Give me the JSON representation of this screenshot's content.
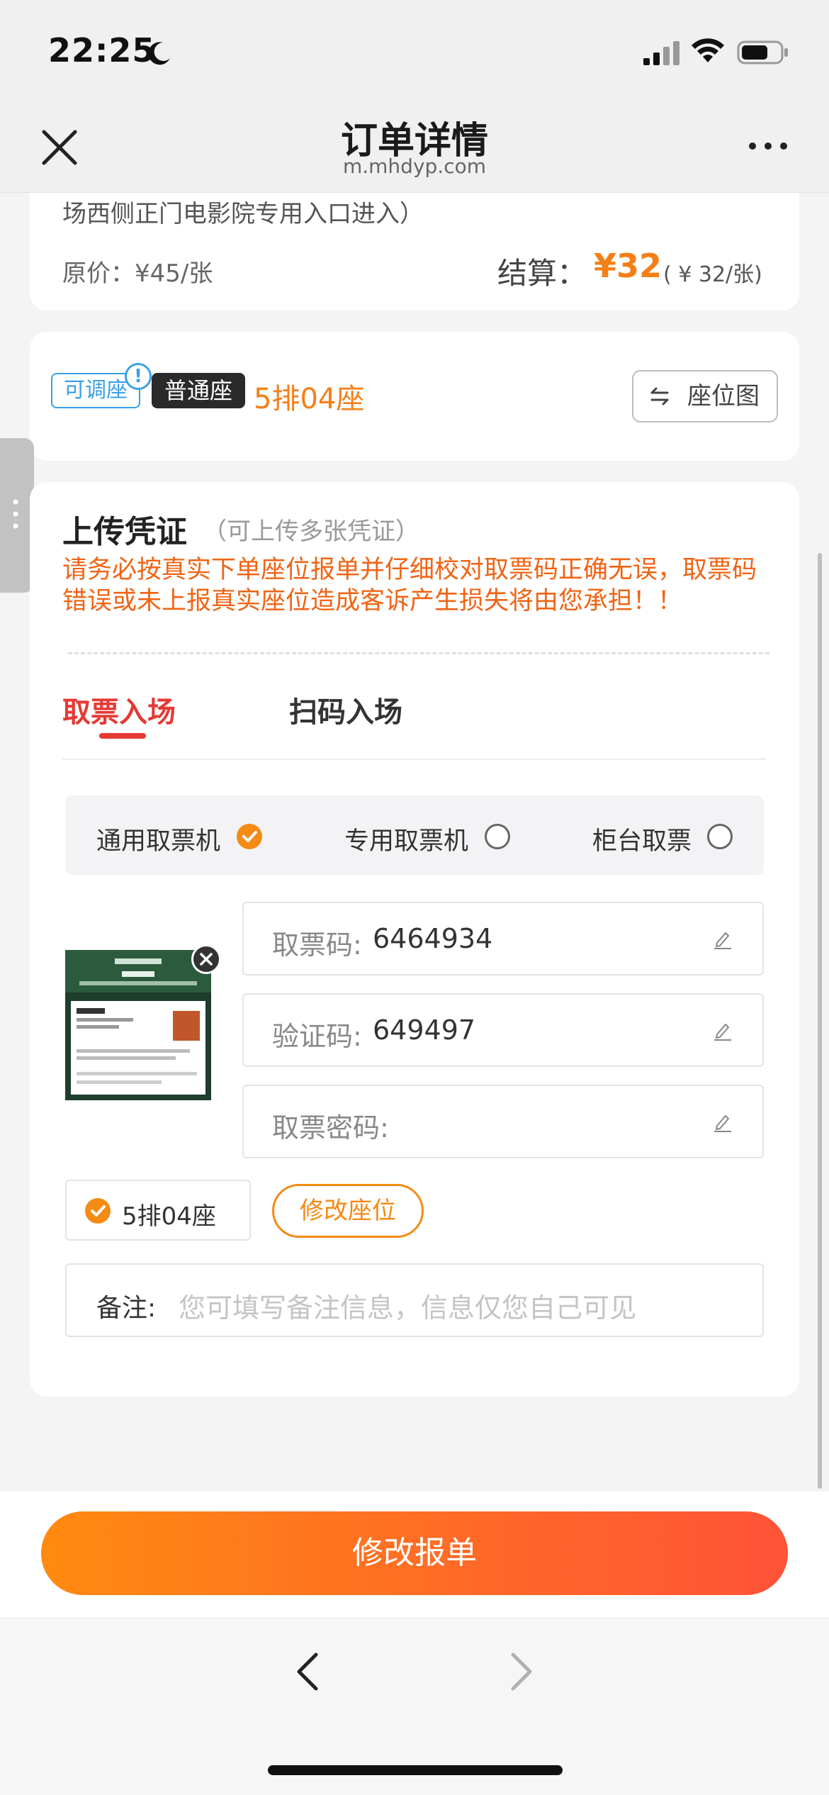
{
  "status_bar": {
    "time": "22:25"
  },
  "nav": {
    "title": "订单详情",
    "url": "m.mhdyp.com"
  },
  "order": {
    "address_tail": "场西侧正门电影院专用入口进入）",
    "original_price": "原价：¥45/张",
    "settle_label": "结算：",
    "settle_value": "¥32",
    "settle_unit": "( ¥ 32/张)"
  },
  "seat": {
    "tag_adjustable": "可调座",
    "tag_info": "!",
    "tag_type": "普通座",
    "seat_label": "5排04座",
    "seat_map_button": "座位图"
  },
  "upload": {
    "title": "上传凭证",
    "hint": "（可上传多张凭证）",
    "warning": "请务必按真实下单座位报单并仔细校对取票码正确无误，取票码错误或未上报真实座位造成客诉产生损失将由您承担！！"
  },
  "tabs": [
    {
      "label": "取票入场",
      "active": true
    },
    {
      "label": "扫码入场",
      "active": false
    }
  ],
  "ticket_options": [
    {
      "label": "通用取票机",
      "selected": true
    },
    {
      "label": "专用取票机",
      "selected": false
    },
    {
      "label": "柜台取票",
      "selected": false
    }
  ],
  "fields": {
    "pickup_code_label": "取票码:",
    "pickup_code_value": "6464934",
    "verify_code_label": "验证码:",
    "verify_code_value": "649497",
    "password_label": "取票密码:",
    "password_value": ""
  },
  "seat_chip": {
    "label": "5排04座",
    "modify_button": "修改座位"
  },
  "remark": {
    "label": "备注:",
    "placeholder": "您可填写备注信息，信息仅您自己可见"
  },
  "submit_button": "修改报单",
  "colors": {
    "accent": "#f58a14",
    "warning": "#f06414",
    "active_tab": "#e53935",
    "info_blue": "#3aa0e6"
  }
}
